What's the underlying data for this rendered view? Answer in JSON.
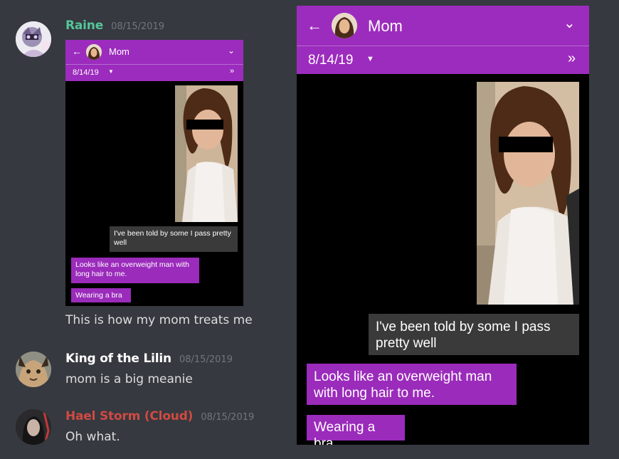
{
  "colors": {
    "accent": "#9c2cbd",
    "bubble_out": "#9b2bbb",
    "bubble_in": "#3a3a3a",
    "chat_bg": "#36393f"
  },
  "messages": [
    {
      "author": "Raine",
      "author_color": "#55c59a",
      "timestamp": "08/15/2019",
      "text": "This is how my mom treats me"
    },
    {
      "author": "King of the Lilin",
      "author_color": "#ffffff",
      "timestamp": "08/15/2019",
      "text": "mom is a big meanie"
    },
    {
      "author": "Hael Storm (Cloud)",
      "author_color": "#d14a43",
      "timestamp": "08/15/2019",
      "text": "Oh what."
    }
  ],
  "sms": {
    "contact": "Mom",
    "date": "8/14/19",
    "back_icon": "back-arrow-icon",
    "menu_icon": "chevron-down-icon",
    "collapse_icon": "double-chevron-down-icon",
    "received": "I've been told by some I pass pretty well",
    "sent": [
      "Looks like an overweight man with long hair to me.",
      "Wearing a bra"
    ]
  }
}
